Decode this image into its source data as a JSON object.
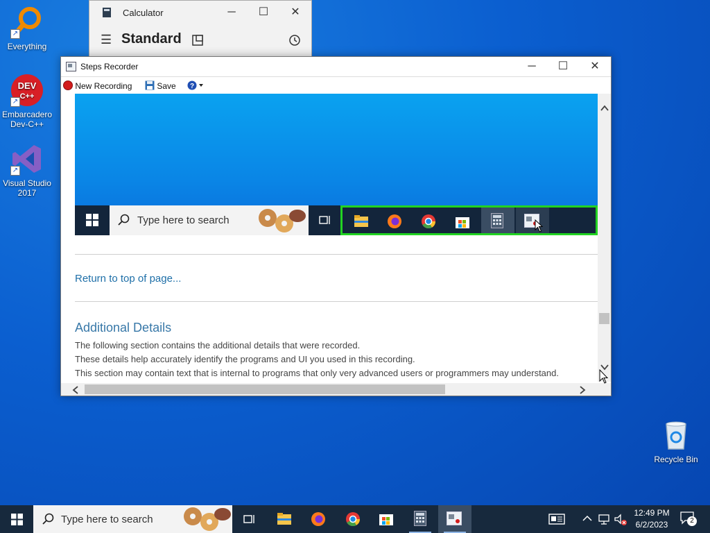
{
  "desktop": {
    "icons": [
      {
        "label": "Everything"
      },
      {
        "label": "Embarcadero Dev-C++"
      },
      {
        "label": "Visual Studio 2017"
      },
      {
        "label": "Recycle Bin"
      }
    ]
  },
  "calculator": {
    "title": "Calculator",
    "mode": "Standard"
  },
  "steps_recorder": {
    "title": "Steps Recorder",
    "toolbar": {
      "new_recording": "New Recording",
      "save": "Save"
    },
    "screenshot": {
      "search_placeholder": "Type here to search"
    },
    "return_link": "Return to top of page...",
    "details_heading": "Additional Details",
    "details_lines": [
      "The following section contains the additional details that were recorded.",
      "These details help accurately identify the programs and UI you used in this recording.",
      "This section may contain text that is internal to programs that only very advanced users or programmers may understand."
    ]
  },
  "taskbar": {
    "search_placeholder": "Type here to search",
    "time": "12:49 PM",
    "date": "6/2/2023",
    "notification_count": "2"
  },
  "colors": {
    "highlight_green": "#22d322",
    "link_blue": "#1e6fa8"
  }
}
